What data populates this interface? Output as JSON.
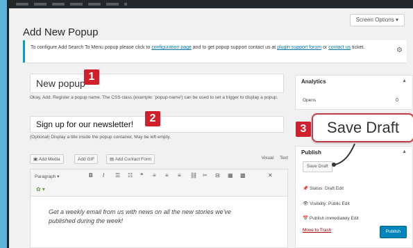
{
  "screen_options": "Screen Options ▾",
  "page_title": "Add New Popup",
  "notice": {
    "text": "To configure Add Search To Menu popup please click to",
    "link1": "configuration page",
    "mid": "and to get popup support contact us at",
    "link2": "plugin support forum",
    "or": "or",
    "link3": "contact us",
    "tail": "ticket."
  },
  "popup_title": "New popup",
  "popup_title_desc": "Okay, Add. Register a popup name. The CSS class (example: 'popup-name') can be used to set a trigger to display a popup.",
  "signup_title": "Sign up for our newsletter!",
  "signup_desc": "(Optional) Display a title inside the popup container. May be left empty.",
  "media": {
    "add_media": "Add Media",
    "add_gif": "Add GIF",
    "add_contact_form": "Add Contact Form",
    "tab_visual": "Visual",
    "tab_text": "Text"
  },
  "toolbar": {
    "paragraph": "Paragraph",
    "bold": "B",
    "italic": "I",
    "list": "≡",
    "quote": "❝",
    "link": "🔗",
    "close": "✕"
  },
  "editor_text": "Get a weekly email from us with news on all the new stories we've published during the week!",
  "analytics": {
    "title": "Analytics",
    "opens_label": "Opens",
    "opens_value": "0"
  },
  "publish": {
    "title": "Publish",
    "save_draft_small": "Save Draft",
    "status": "Status: Draft Edit",
    "visibility": "Visibility: Public Edit",
    "publish_time": "Publish immediately Edit",
    "move_to_trash": "Move to Trash",
    "publish_button": "Publish"
  },
  "badges": {
    "one": "1",
    "two": "2",
    "three": "3"
  },
  "callout_label": "Save Draft",
  "colors": {
    "badge_red": "#d0202c",
    "link_blue": "#0073aa",
    "publish_blue": "#0085ba",
    "callout_border": "#c43a48"
  }
}
